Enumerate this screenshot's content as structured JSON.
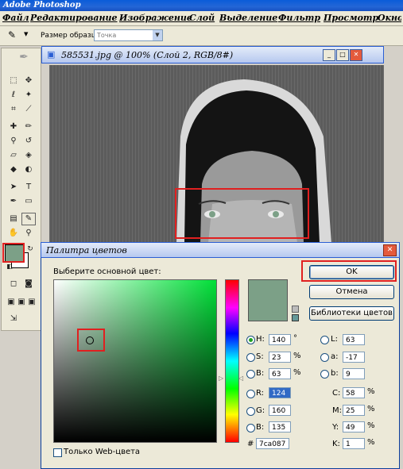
{
  "app": {
    "title": "Adobe Photoshop"
  },
  "menu": {
    "items": [
      "Файл",
      "Редактирование",
      "Изображение",
      "Слой",
      "Выделение",
      "Фильтр",
      "Просмотр",
      "Окно"
    ]
  },
  "options_bar": {
    "sample_size_label": "Размер образца:",
    "sample_size_value": "Точка"
  },
  "document": {
    "title": "585531.jpg @ 100% (Слой 2, RGB/8#)"
  },
  "colors": {
    "foreground": "#7ca087",
    "highlight": "#e02020"
  },
  "dialog": {
    "title": "Палитра цветов",
    "select_label": "Выберите основной цвет:",
    "ok_label": "OK",
    "cancel_label": "Отмена",
    "libraries_label": "Библиотеки цветов",
    "web_only_label": "Только Web-цвета",
    "hsb": {
      "h_label": "H:",
      "h_value": "140",
      "h_unit": "°",
      "s_label": "S:",
      "s_value": "23",
      "s_unit": "%",
      "b_label": "B:",
      "b_value": "63",
      "b_unit": "%"
    },
    "rgb": {
      "r_label": "R:",
      "r_value": "124",
      "g_label": "G:",
      "g_value": "160",
      "b_label": "B:",
      "b_value": "135"
    },
    "lab": {
      "l_label": "L:",
      "l_value": "63",
      "a_label": "a:",
      "a_value": "-17",
      "b_label": "b:",
      "b_value": "9"
    },
    "cmyk": {
      "c_label": "C:",
      "c_value": "58",
      "m_label": "M:",
      "m_value": "25",
      "y_label": "Y:",
      "y_value": "49",
      "k_label": "K:",
      "k_value": "1",
      "unit": "%"
    },
    "hex_label": "#",
    "hex_value": "7ca087"
  }
}
